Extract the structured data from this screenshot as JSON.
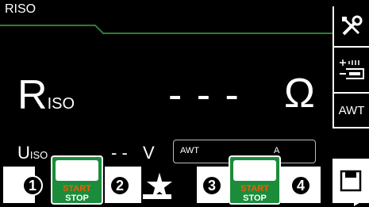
{
  "header": {
    "title": "RISO"
  },
  "measurement": {
    "symbol_main": "R",
    "symbol_sub": "ISO",
    "value": "- - -",
    "unit": "Ω"
  },
  "voltage": {
    "symbol_main": "U",
    "symbol_sub": "ISO",
    "value": "- -",
    "unit": "V"
  },
  "awt_field": {
    "label": "AWT",
    "unit": "A"
  },
  "sidebar": {
    "items": [
      {
        "icon": "tools-icon"
      },
      {
        "icon": "probe-icon"
      },
      {
        "label": "AWT"
      },
      {
        "icon": "save-icon"
      }
    ]
  },
  "steps": [
    "1",
    "2",
    "3",
    "4"
  ],
  "start_button": {
    "line1": "START",
    "line2": "STOP"
  },
  "colors": {
    "accent_green": "#1a8c3a",
    "start_text": "#e8600a",
    "header_line": "#2e7d32"
  }
}
